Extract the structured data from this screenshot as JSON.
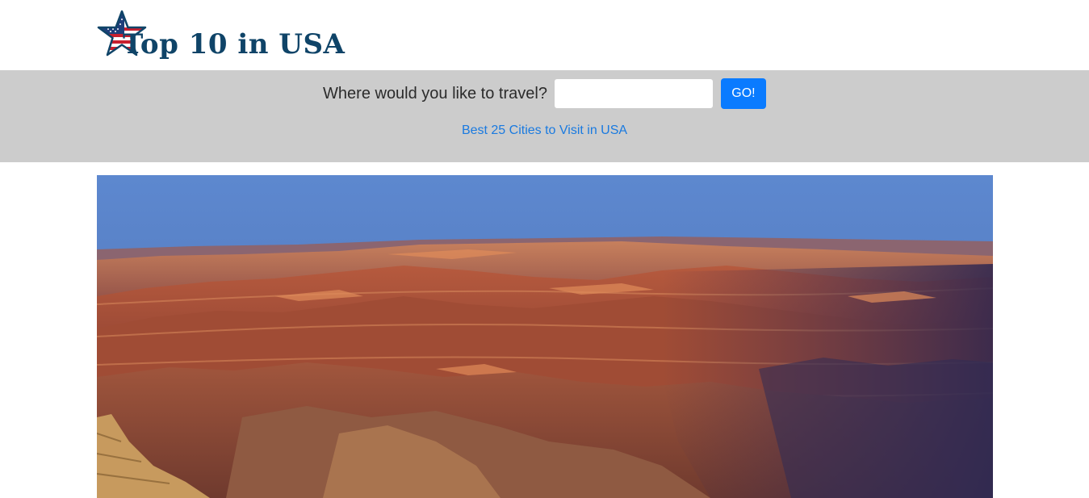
{
  "site": {
    "logo_text": "Top 10 in USA",
    "logo_icon": "american-flag-star-icon",
    "brand_color": "#0f4468"
  },
  "search": {
    "prompt": "Where would you like to travel?",
    "input_value": "",
    "placeholder": "",
    "button_label": "GO!",
    "button_color": "#0a7bff",
    "band_color": "#cccccc"
  },
  "links": {
    "best_cities": "Best 25 Cities to Visit in USA",
    "link_color": "#1a7ae0"
  },
  "hero": {
    "image_subject": "grand-canyon-photo",
    "alt": ""
  }
}
